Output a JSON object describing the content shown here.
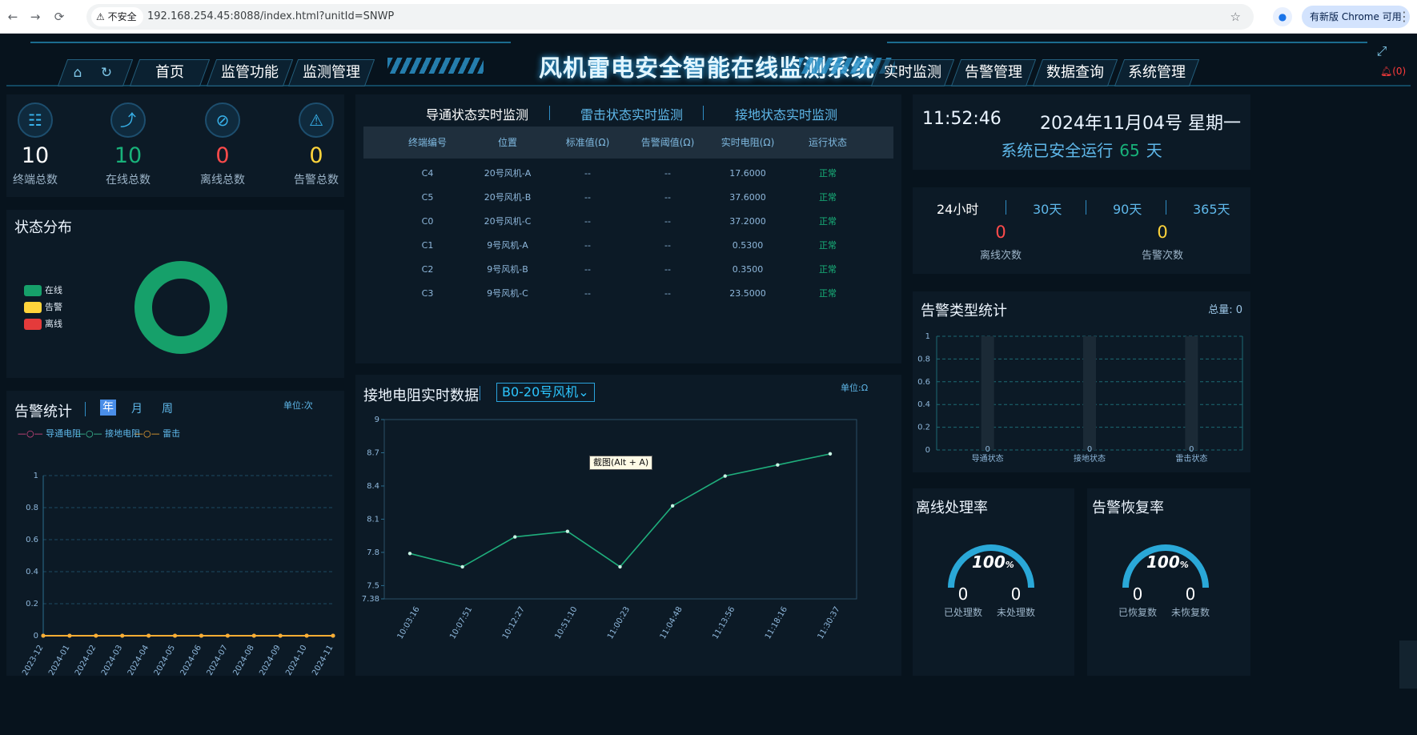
{
  "browser": {
    "insecure_label": "不安全",
    "url": "192.168.254.45:8088/index.html?unitId=SNWP",
    "update_label": "有新版 Chrome 可用"
  },
  "header": {
    "title": "风机雷电安全智能在线监测系统",
    "left_nav": [
      "首页",
      "监管功能",
      "监测管理"
    ],
    "right_nav": [
      "实时监测",
      "告警管理",
      "数据查询",
      "系统管理"
    ],
    "alarm_count": "(0)"
  },
  "stats": [
    {
      "value": "10",
      "label": "终端总数",
      "color": "#ffffff",
      "icon": "terminal-icon"
    },
    {
      "value": "10",
      "label": "在线总数",
      "color": "#18b27a",
      "icon": "online-trend-icon"
    },
    {
      "value": "0",
      "label": "离线总数",
      "color": "#ff4b4b",
      "icon": "offline-icon"
    },
    {
      "value": "0",
      "label": "告警总数",
      "color": "#ffd43b",
      "icon": "alarm-icon"
    }
  ],
  "status_dist": {
    "title": "状态分布",
    "legend": [
      {
        "label": "在线",
        "color": "#16a06a"
      },
      {
        "label": "告警",
        "color": "#ffd43b"
      },
      {
        "label": "离线",
        "color": "#e43b3b"
      }
    ]
  },
  "alarm_stat": {
    "title": "告警统计",
    "periods": [
      "年",
      "月",
      "周"
    ],
    "active_period": "年",
    "unit": "单位:次",
    "legend": [
      {
        "label": "导通电阻",
        "color": "#e84b8a"
      },
      {
        "label": "接地电阻",
        "color": "#3fd0a0"
      },
      {
        "label": "雷击",
        "color": "#ffad33"
      }
    ]
  },
  "monitor_tabs": [
    "导通状态实时监测",
    "雷击状态实时监测",
    "接地状态实时监测"
  ],
  "table": {
    "headers": [
      "终端编号",
      "位置",
      "标准值(Ω)",
      "告警阈值(Ω)",
      "实时电阻(Ω)",
      "运行状态"
    ],
    "rows": [
      [
        "C4",
        "20号风机-A",
        "--",
        "--",
        "17.6000",
        "正常"
      ],
      [
        "C5",
        "20号风机-B",
        "--",
        "--",
        "37.6000",
        "正常"
      ],
      [
        "C0",
        "20号风机-C",
        "--",
        "--",
        "37.2000",
        "正常"
      ],
      [
        "C1",
        "9号风机-A",
        "--",
        "--",
        "0.5300",
        "正常"
      ],
      [
        "C2",
        "9号风机-B",
        "--",
        "--",
        "0.3500",
        "正常"
      ],
      [
        "C3",
        "9号风机-C",
        "--",
        "--",
        "23.5000",
        "正常"
      ]
    ]
  },
  "ground": {
    "title": "接地电阻实时数据",
    "select": "B0-20号风机",
    "unit": "单位:Ω",
    "tooltip": "截图(Alt + A)"
  },
  "time_panel": {
    "time": "11:52:46",
    "date": "2024年11月04号 星期一",
    "safe_prefix": "系统已安全运行",
    "safe_days": "65",
    "safe_suffix": "天"
  },
  "period_panel": {
    "periods": [
      "24小时",
      "30天",
      "90天",
      "365天"
    ],
    "active": "24小时",
    "offline_value": "0",
    "offline_label": "离线次数",
    "alarm_value": "0",
    "alarm_label": "告警次数"
  },
  "alarm_type": {
    "title": "告警类型统计",
    "total": "总量: 0"
  },
  "offline_rate": {
    "title": "离线处理率",
    "percent": "100",
    "left_value": "0",
    "left_label": "已处理数",
    "right_value": "0",
    "right_label": "未处理数"
  },
  "recover_rate": {
    "title": "告警恢复率",
    "percent": "100",
    "left_value": "0",
    "left_label": "已恢复数",
    "right_value": "0",
    "right_label": "未恢复数"
  },
  "chart_data": [
    {
      "type": "pie",
      "categories": [
        "在线",
        "告警",
        "离线"
      ],
      "values": [
        10,
        0,
        0
      ],
      "colors": [
        "#16a06a",
        "#ffd43b",
        "#e43b3b"
      ]
    },
    {
      "type": "line",
      "x": [
        "2023-12",
        "2024-01",
        "2024-02",
        "2024-03",
        "2024-04",
        "2024-05",
        "2024-06",
        "2024-07",
        "2024-08",
        "2024-09",
        "2024-10",
        "2024-11"
      ],
      "yticks": [
        "0",
        "0.2",
        "0.4",
        "0.6",
        "0.8",
        "1"
      ],
      "ylim": [
        0,
        1
      ],
      "series": [
        {
          "name": "导通电阻",
          "values": [
            0,
            0,
            0,
            0,
            0,
            0,
            0,
            0,
            0,
            0,
            0,
            0
          ]
        },
        {
          "name": "接地电阻",
          "values": [
            0,
            0,
            0,
            0,
            0,
            0,
            0,
            0,
            0,
            0,
            0,
            0
          ]
        },
        {
          "name": "雷击",
          "values": [
            0,
            0,
            0,
            0,
            0,
            0,
            0,
            0,
            0,
            0,
            0,
            0
          ]
        }
      ]
    },
    {
      "type": "line",
      "x": [
        "10:03:16",
        "10:07:51",
        "10:12:27",
        "10:51:10",
        "11:00:23",
        "11:04:48",
        "11:13:56",
        "11:18:16",
        "11:30:37"
      ],
      "values": [
        7.79,
        7.67,
        7.94,
        7.99,
        7.67,
        8.22,
        8.49,
        8.59,
        8.69
      ],
      "yticks": [
        "7.38",
        "7.5",
        "7.8",
        "8.1",
        "8.4",
        "8.7",
        "9"
      ],
      "ylim": [
        7.38,
        9
      ],
      "line_color": "#1fae7c"
    },
    {
      "type": "bar",
      "categories": [
        "导通状态",
        "接地状态",
        "雷击状态"
      ],
      "values": [
        0,
        0,
        0
      ],
      "yticks": [
        "0",
        "0.2",
        "0.4",
        "0.6",
        "0.8",
        "1"
      ],
      "ylim": [
        0,
        1
      ]
    }
  ]
}
